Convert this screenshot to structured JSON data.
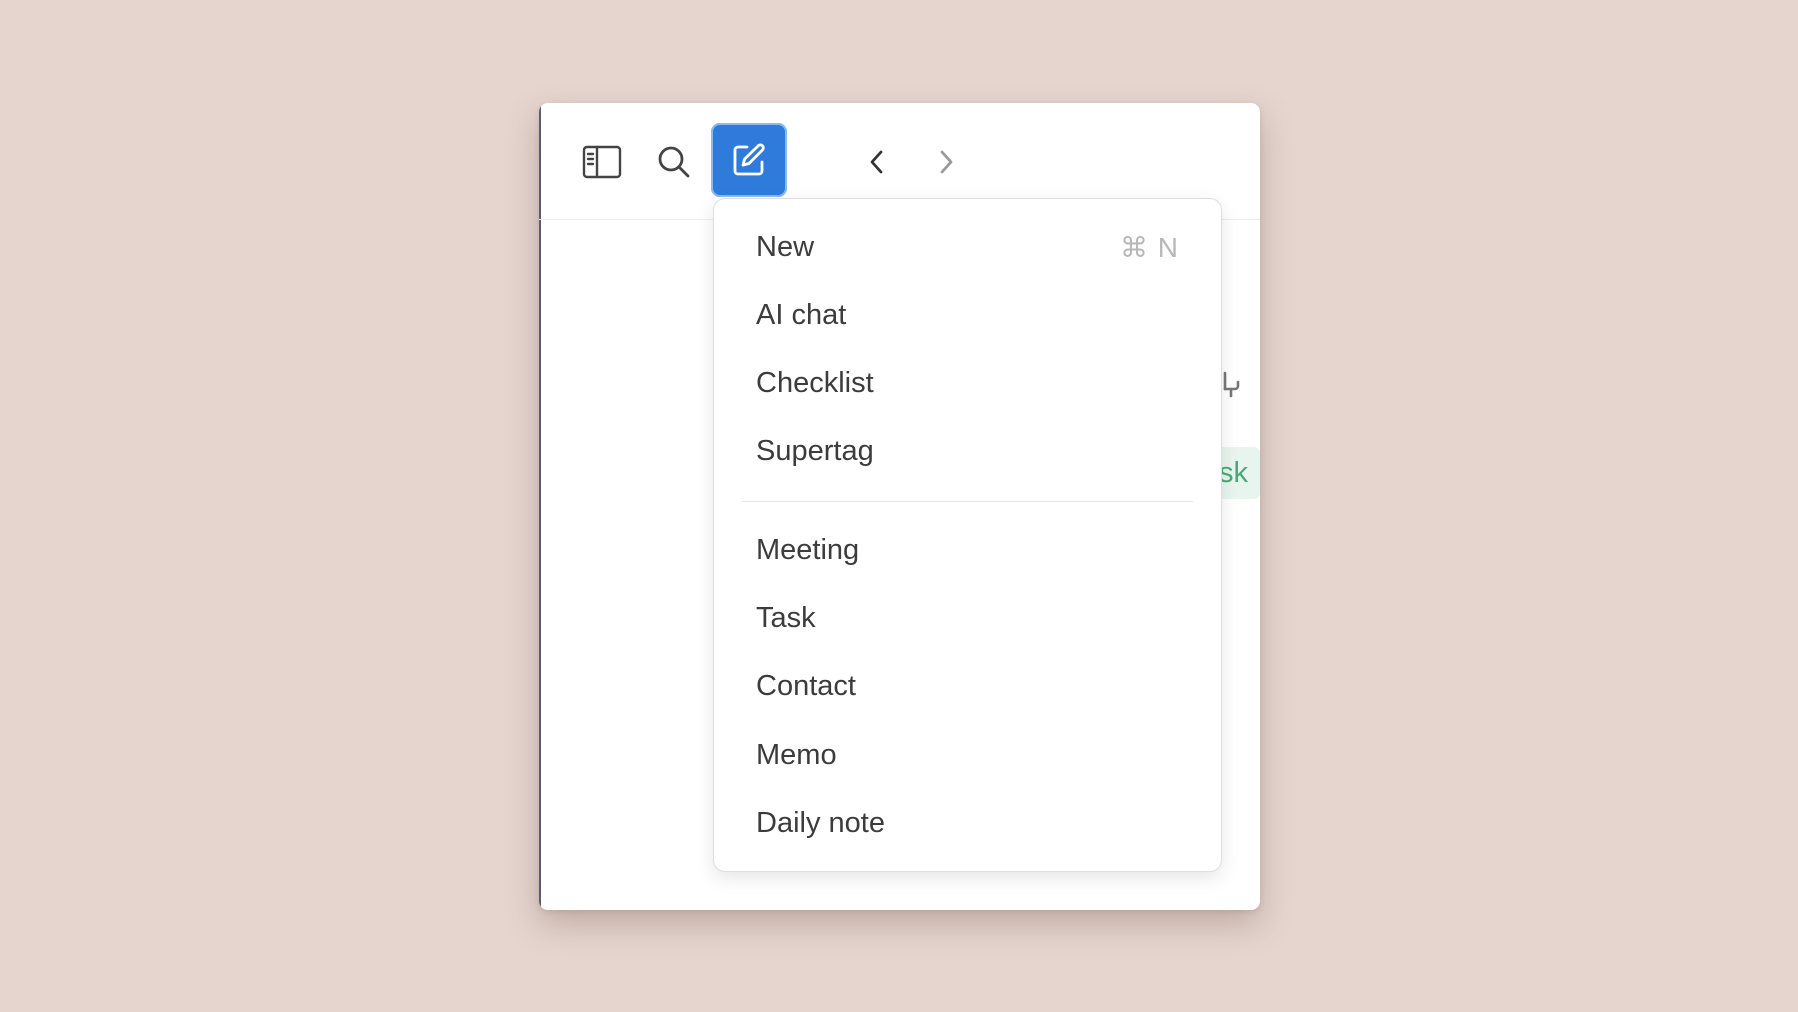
{
  "toolbar": {
    "icons": {
      "sidebar": "sidebar-toggle-icon",
      "search": "search-icon",
      "new": "compose-icon",
      "back": "chevron-left-icon",
      "forward": "chevron-right-icon"
    },
    "accent_color": "#2f7bdc"
  },
  "background_content": {
    "chip_text": "sk",
    "chip_color": "#4aa878"
  },
  "menu": {
    "sections": [
      {
        "items": [
          {
            "label": "New",
            "shortcut": "⌘ N"
          },
          {
            "label": "AI chat"
          },
          {
            "label": "Checklist"
          },
          {
            "label": "Supertag"
          }
        ]
      },
      {
        "items": [
          {
            "label": "Meeting"
          },
          {
            "label": "Task"
          },
          {
            "label": "Contact"
          },
          {
            "label": "Memo"
          },
          {
            "label": "Daily note"
          }
        ]
      }
    ]
  }
}
